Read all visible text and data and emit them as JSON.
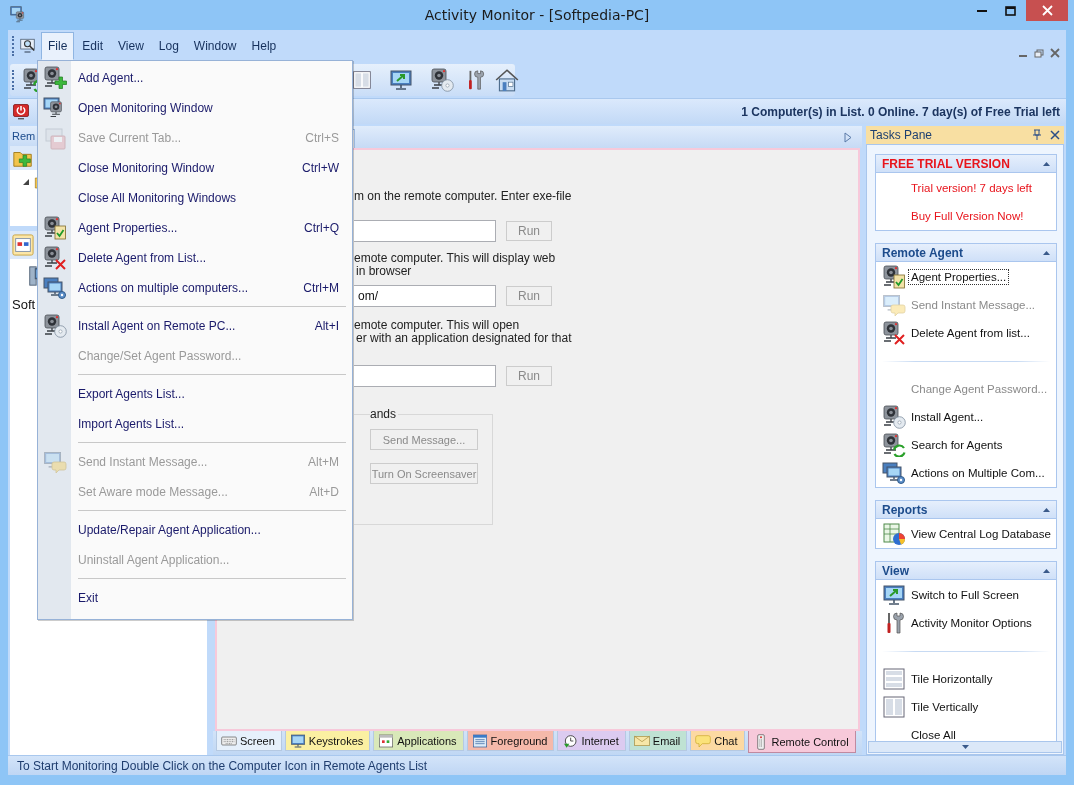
{
  "window": {
    "title": "Activity Monitor - [Softpedia-PC]"
  },
  "menu_bar": {
    "items": [
      {
        "label": "File",
        "selected": true
      },
      {
        "label": "Edit",
        "selected": false
      },
      {
        "label": "View",
        "selected": false
      },
      {
        "label": "Log",
        "selected": false
      },
      {
        "label": "Window",
        "selected": false
      },
      {
        "label": "Help",
        "selected": false
      }
    ]
  },
  "file_menu": {
    "entries": [
      {
        "kind": "item",
        "label": "Add Agent...",
        "disabled": false
      },
      {
        "kind": "item",
        "label": "Open Monitoring Window",
        "disabled": false
      },
      {
        "kind": "item",
        "label": "Save Current Tab...",
        "shortcut": "Ctrl+S",
        "disabled": true
      },
      {
        "kind": "item",
        "label": "Close Monitoring Window",
        "shortcut": "Ctrl+W",
        "disabled": false
      },
      {
        "kind": "item",
        "label": "Close All Monitoring Windows",
        "disabled": false
      },
      {
        "kind": "item",
        "label": "Agent Properties...",
        "shortcut": "Ctrl+Q",
        "disabled": false
      },
      {
        "kind": "item",
        "label": "Delete Agent from List...",
        "disabled": false
      },
      {
        "kind": "item",
        "label": "Actions on multiple computers...",
        "shortcut": "Ctrl+M",
        "disabled": false
      },
      {
        "kind": "separator"
      },
      {
        "kind": "item",
        "label": "Install Agent on Remote PC...",
        "shortcut": "Alt+I",
        "disabled": false
      },
      {
        "kind": "item",
        "label": "Change/Set Agent Password...",
        "disabled": true
      },
      {
        "kind": "separator"
      },
      {
        "kind": "item",
        "label": "Export Agents List...",
        "disabled": false
      },
      {
        "kind": "item",
        "label": "Import Agents List...",
        "disabled": false
      },
      {
        "kind": "separator"
      },
      {
        "kind": "item",
        "label": "Send Instant Message...",
        "shortcut": "Alt+M",
        "disabled": true
      },
      {
        "kind": "item",
        "label": "Set Aware mode Message...",
        "shortcut": "Alt+D",
        "disabled": true
      },
      {
        "kind": "separator"
      },
      {
        "kind": "item",
        "label": "Update/Repair Agent Application...",
        "disabled": false
      },
      {
        "kind": "item",
        "label": "Uninstall Agent Application...",
        "disabled": true
      },
      {
        "kind": "separator"
      },
      {
        "kind": "item",
        "label": "Exit",
        "disabled": false
      }
    ]
  },
  "info_bar": {
    "text": "1 Computer(s) in List. 0 Online. 7 day(s) of Free Trial left"
  },
  "left_panel": {
    "title": "Rem",
    "tree": [
      {
        "expanded": true
      }
    ],
    "agents": [
      {
        "label": "Soft"
      }
    ]
  },
  "document": {
    "sections": [
      {
        "lines": [
          "m on the remote computer. Enter exe-file"
        ],
        "run_button": {
          "label": "Run",
          "disabled": true
        }
      },
      {
        "lines": [
          "emote computer. This will display web",
          "in browser"
        ],
        "field_value": "om/",
        "run_button": {
          "label": "Run",
          "disabled": true
        }
      },
      {
        "lines": [
          "emote computer. This will open",
          "er with an application designated for that"
        ],
        "run_button": {
          "label": "Run",
          "disabled": true
        }
      }
    ],
    "commands": {
      "legend": "ands",
      "buttons": [
        {
          "label": "Send Message...",
          "disabled": true
        },
        {
          "label": "Turn On Screensaver",
          "disabled": true
        }
      ]
    }
  },
  "bottom_tabs": [
    {
      "label": "Screen",
      "color": "#e6f0fb",
      "selected": false
    },
    {
      "label": "Keystrokes",
      "color": "#fbf0a2",
      "selected": false
    },
    {
      "label": "Applications",
      "color": "#d9e8b9",
      "selected": false
    },
    {
      "label": "Foreground",
      "color": "#f5b9aa",
      "selected": false
    },
    {
      "label": "Internet",
      "color": "#dccbf0",
      "selected": false
    },
    {
      "label": "Email",
      "color": "#bfe2d3",
      "selected": false
    },
    {
      "label": "Chat",
      "color": "#fcd9a2",
      "selected": false
    },
    {
      "label": "Remote Control",
      "color": "#f7c9da",
      "selected": true
    }
  ],
  "tasks_pane": {
    "title": "Tasks Pane",
    "groups": [
      {
        "kind": "trial",
        "title": "FREE TRIAL VERSION",
        "expanded": true,
        "items": [
          {
            "kind": "link",
            "label": "Trial version! 7 days left",
            "disabled": false,
            "focused": false
          },
          {
            "kind": "link",
            "label": "Buy Full Version Now!",
            "disabled": false,
            "focused": false
          }
        ]
      },
      {
        "kind": "normal",
        "title": "Remote Agent",
        "expanded": true,
        "items": [
          {
            "kind": "item",
            "label": "Agent Properties...",
            "disabled": false,
            "focused": true
          },
          {
            "kind": "item",
            "label": "Send Instant Message...",
            "disabled": true,
            "focused": false
          },
          {
            "kind": "item",
            "label": "Delete Agent from list...",
            "disabled": false,
            "focused": false
          },
          {
            "kind": "separator"
          },
          {
            "kind": "item",
            "label": "Change Agent Password...",
            "disabled": true,
            "focused": false
          },
          {
            "kind": "item",
            "label": "Install Agent...",
            "disabled": false,
            "focused": false
          },
          {
            "kind": "item",
            "label": "Search for Agents",
            "disabled": false,
            "focused": false
          },
          {
            "kind": "item",
            "label": "Actions on Multiple Com...",
            "disabled": false,
            "focused": false
          }
        ]
      },
      {
        "kind": "normal",
        "title": "Reports",
        "expanded": true,
        "items": [
          {
            "kind": "item",
            "label": "View Central Log Database",
            "disabled": false,
            "focused": false
          }
        ]
      },
      {
        "kind": "normal",
        "title": "View",
        "expanded": true,
        "items": [
          {
            "kind": "item",
            "label": "Switch to Full Screen",
            "disabled": false,
            "focused": false
          },
          {
            "kind": "item",
            "label": "Activity Monitor Options",
            "disabled": false,
            "focused": false
          },
          {
            "kind": "separator"
          },
          {
            "kind": "item",
            "label": "Tile Horizontally",
            "disabled": false,
            "focused": false
          },
          {
            "kind": "item",
            "label": "Tile Vertically",
            "disabled": false,
            "focused": false
          },
          {
            "kind": "item",
            "label": "Close All",
            "disabled": false,
            "focused": false
          }
        ]
      }
    ]
  },
  "status_bar": {
    "text": "To Start Monitoring Double Click on the Computer Icon in Remote Agents List"
  }
}
